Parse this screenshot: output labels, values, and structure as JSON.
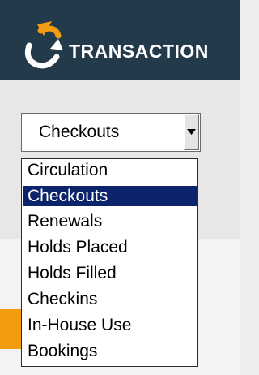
{
  "header": {
    "title": "TRANSACTION",
    "background": "#233a4b",
    "logo_icon": "transaction-logo-icon"
  },
  "select": {
    "value": "Checkouts",
    "button_icon": "triangle-down-icon"
  },
  "dropdown": {
    "selected_index": 1,
    "selected_color": "#0c246b",
    "options": [
      "Circulation",
      "Checkouts",
      "Renewals",
      "Holds Placed",
      "Holds Filled",
      "Checkins",
      "In-House Use",
      "Bookings"
    ]
  },
  "colors": {
    "accent_orange": "#f39c12"
  }
}
